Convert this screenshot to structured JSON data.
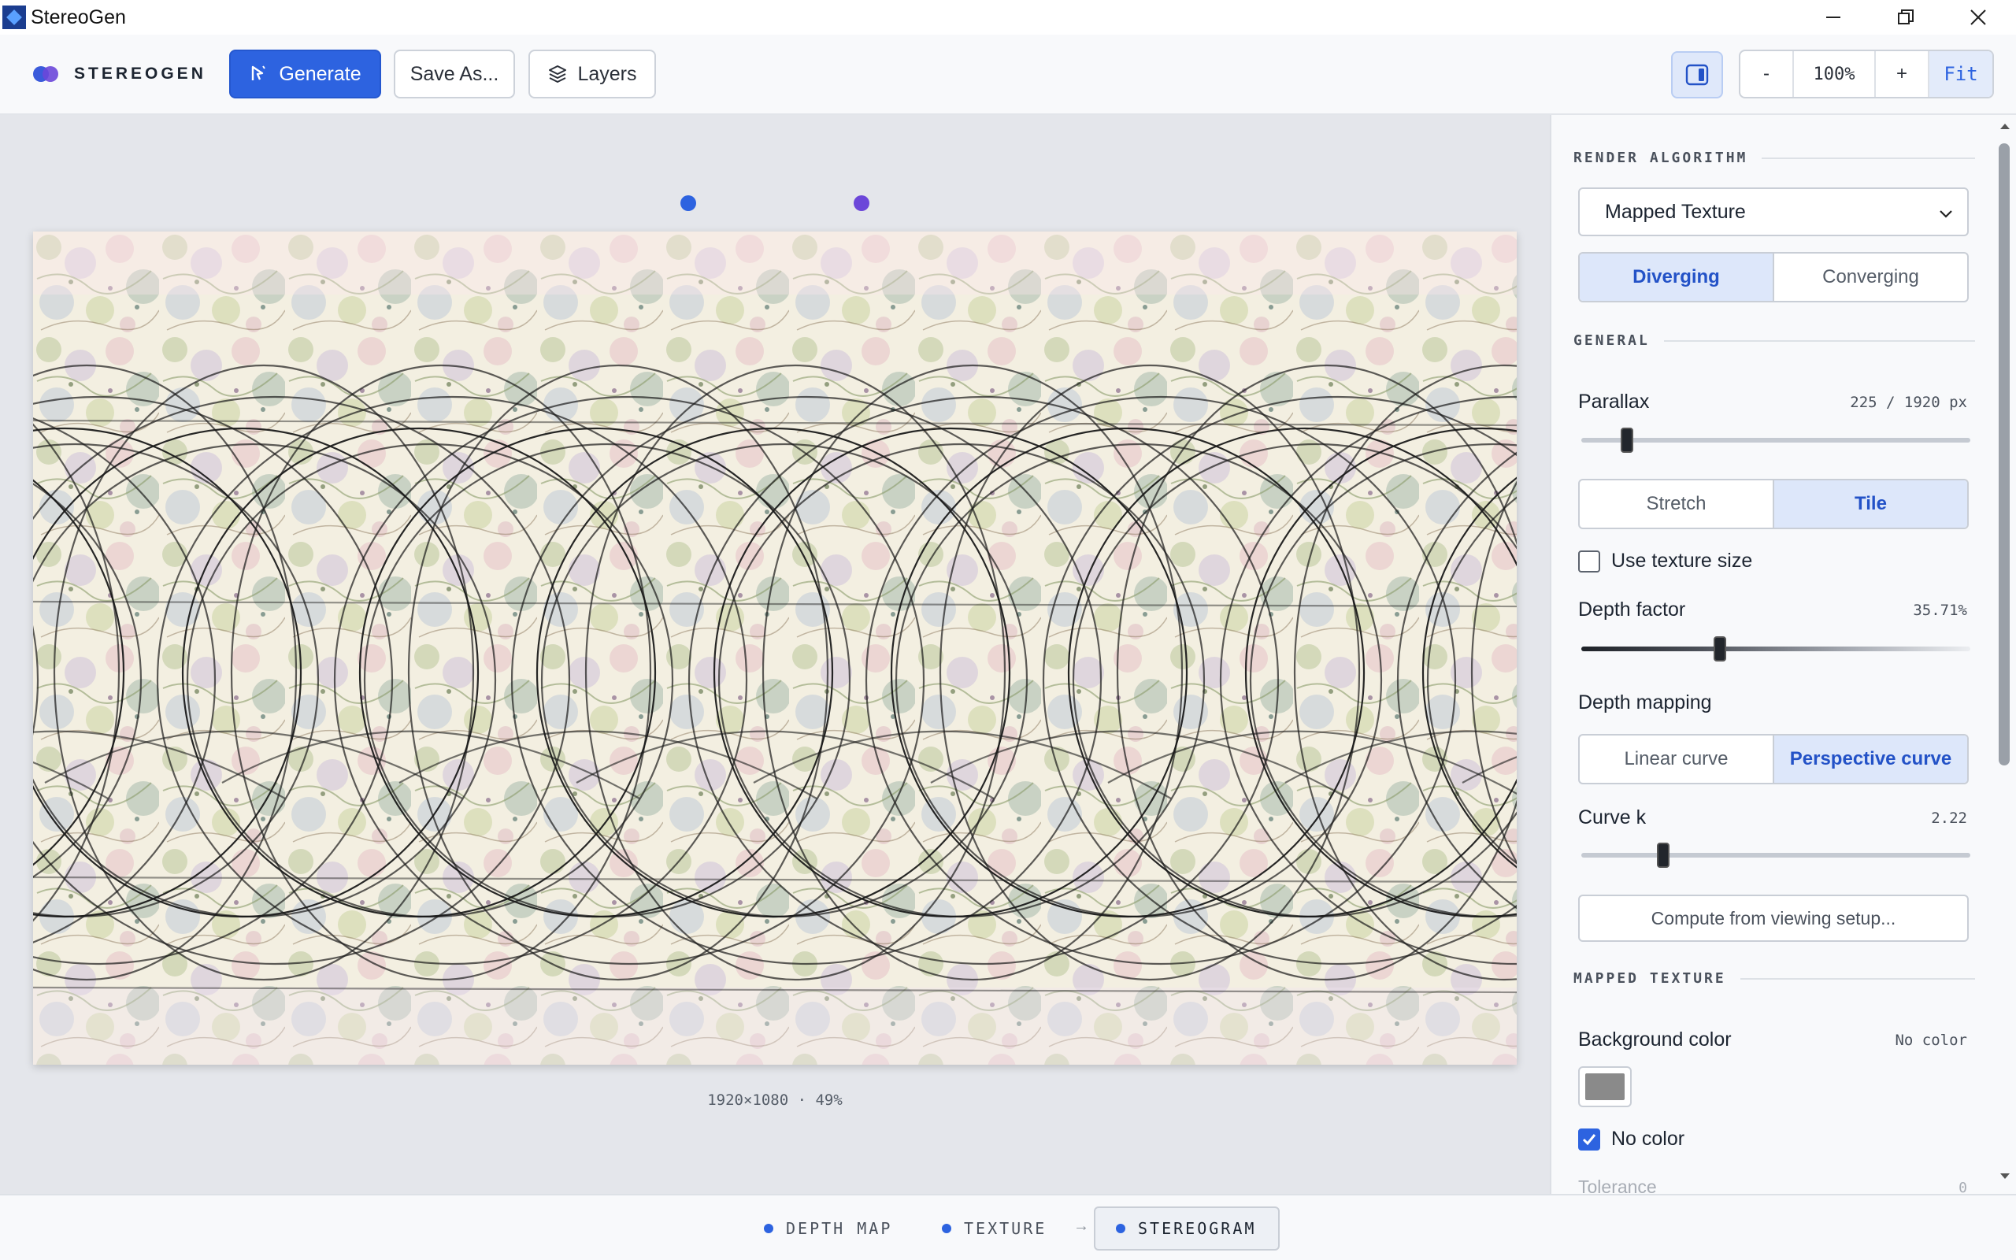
{
  "window": {
    "title": "StereoGen"
  },
  "toolbar": {
    "logo_text": "STEREOGEN",
    "generate_label": "Generate",
    "save_label": "Save As...",
    "layers_label": "Layers",
    "zoom_minus": "-",
    "zoom_value": "100%",
    "zoom_plus": "+",
    "fit_label": "Fit"
  },
  "canvas": {
    "info": "1920×1080 · 49%",
    "guide_colors": [
      "#2d63e0",
      "#6c47d9"
    ]
  },
  "panel": {
    "render_algorithm": {
      "heading": "RENDER ALGORITHM",
      "selected": "Mapped Texture",
      "mode_options": [
        "Diverging",
        "Converging"
      ],
      "mode_selected": "Diverging"
    },
    "general": {
      "heading": "GENERAL",
      "parallax_label": "Parallax",
      "parallax_value": "225 / 1920 px",
      "parallax_fraction": 0.117,
      "fill_options": [
        "Stretch",
        "Tile"
      ],
      "fill_selected": "Tile",
      "use_texture_size_label": "Use texture size",
      "use_texture_size_checked": false,
      "depth_factor_label": "Depth factor",
      "depth_factor_value": "35.71%",
      "depth_factor_fraction": 0.3571,
      "depth_mapping_label": "Depth mapping",
      "mapping_options": [
        "Linear curve",
        "Perspective curve"
      ],
      "mapping_selected": "Perspective curve",
      "curve_k_label": "Curve k",
      "curve_k_value": "2.22",
      "curve_k_fraction": 0.21,
      "compute_label": "Compute from viewing setup..."
    },
    "mapped_texture": {
      "heading": "MAPPED TEXTURE",
      "background_color_label": "Background color",
      "background_color_value": "No color",
      "swatch_color": "#8a8a8a",
      "no_color_label": "No color",
      "no_color_checked": true,
      "tolerance_label": "Tolerance",
      "tolerance_value": "0"
    }
  },
  "bottom_tabs": [
    {
      "label": "DEPTH MAP",
      "active": false
    },
    {
      "label": "TEXTURE",
      "active": false
    },
    {
      "label": "STEREOGRAM",
      "active": true
    }
  ],
  "colors": {
    "accent": "#2d63e0",
    "accent_soft": "#dde7fa"
  }
}
